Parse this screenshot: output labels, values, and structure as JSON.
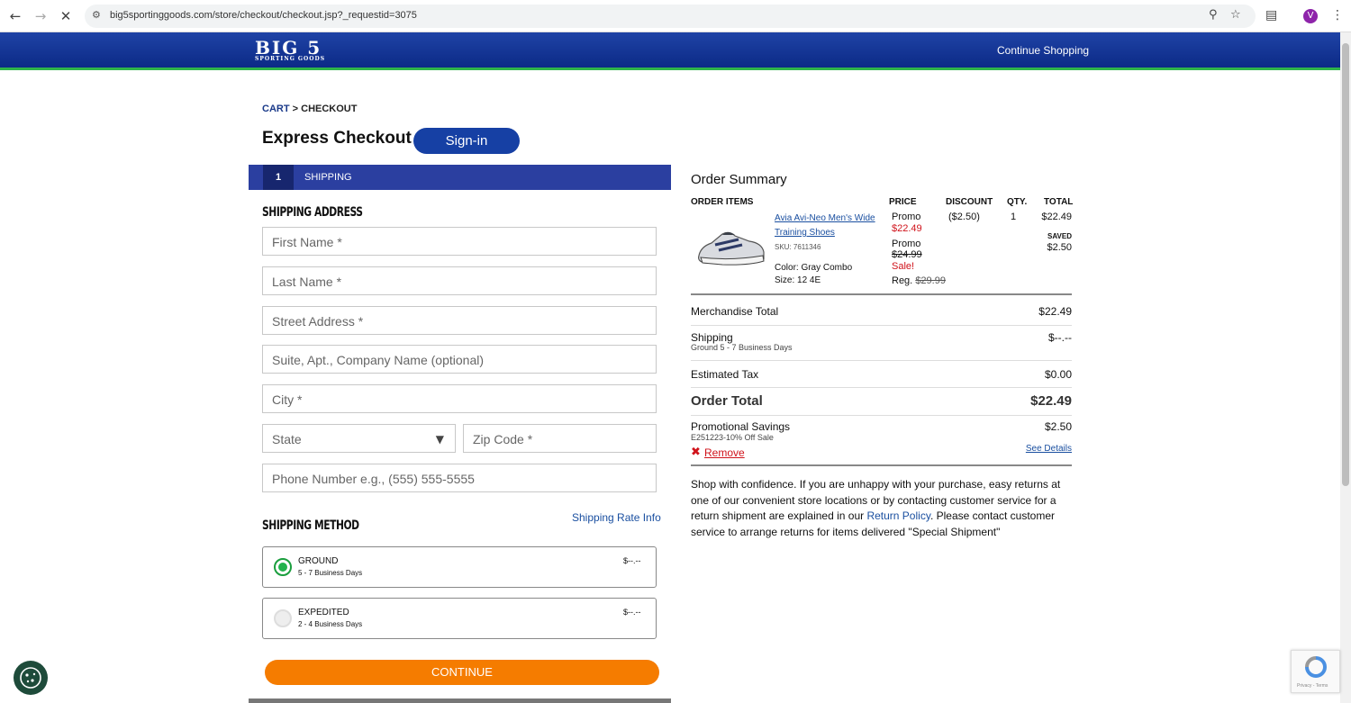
{
  "browser": {
    "url": "big5sportinggoods.com/store/checkout/checkout.jsp?_requestid=3075",
    "profile_initial": "V"
  },
  "header": {
    "logo_main": "BIG 5",
    "logo_sub": "SPORTING GOODS",
    "continue_shopping": "Continue Shopping"
  },
  "breadcrumb": {
    "cart": "CART",
    "sep": ">",
    "current": "CHECKOUT"
  },
  "page": {
    "title": "Express Checkout",
    "signin_label": "Sign-in"
  },
  "step": {
    "number": "1",
    "label": "SHIPPING"
  },
  "shipping_address": {
    "heading": "SHIPPING ADDRESS",
    "first_name": "First Name *",
    "last_name": "Last Name *",
    "street": "Street Address *",
    "suite": "Suite, Apt., Company Name (optional)",
    "city": "City *",
    "state": "State",
    "zip": "Zip Code *",
    "phone": "Phone Number e.g., (555) 555-5555"
  },
  "shipping_method": {
    "heading": "SHIPPING METHOD",
    "rate_info": "Shipping Rate Info",
    "options": [
      {
        "name": "GROUND",
        "days": "5 - 7 Business Days",
        "price": "$--.--",
        "selected": true
      },
      {
        "name": "EXPEDITED",
        "days": "2 - 4 Business Days",
        "price": "$--.--",
        "selected": false
      }
    ],
    "continue_label": "CONTINUE"
  },
  "order_summary": {
    "title": "Order Summary",
    "columns": {
      "items": "ORDER ITEMS",
      "price": "PRICE",
      "discount": "DISCOUNT",
      "qty": "QTY.",
      "total": "TOTAL"
    },
    "item": {
      "name": "Avia Avi-Neo Men's Wide Training Shoes",
      "sku": "SKU:  7611346",
      "color": "Color:  Gray Combo",
      "size": "Size:  12 4E",
      "promo_label_1": "Promo",
      "promo_price": "$22.49",
      "promo_label_2": "Promo",
      "was_price": "$24.99",
      "sale": "Sale!",
      "reg_label": "Reg.",
      "reg_price": "$29.99",
      "discount": "($2.50)",
      "qty": "1",
      "total": "$22.49",
      "saved_label": "SAVED",
      "saved_amount": "$2.50"
    },
    "merch_total_label": "Merchandise Total",
    "merch_total": "$22.49",
    "shipping_label": "Shipping",
    "shipping_sub": "Ground  5 - 7 Business Days",
    "shipping_value": "$--.--",
    "tax_label": "Estimated Tax",
    "tax_value": "$0.00",
    "order_total_label": "Order Total",
    "order_total": "$22.49",
    "promo_label": "Promotional Savings",
    "promo_code": "E251223-10% Off Sale",
    "promo_value": "$2.50",
    "remove_label": "Remove",
    "see_details": "See Details",
    "confidence_1": "Shop with confidence. If you are unhappy with your purchase, easy returns at one of our convenient store locations or by contacting customer service for a return shipment are explained in our ",
    "return_policy": "Return Policy",
    "confidence_2": ". Please contact customer service to arrange returns for items delivered \"Special Shipment\""
  },
  "colors": {
    "brand_blue": "#0c2a86",
    "accent_orange": "#f57c00",
    "promo_red": "#d0131b",
    "radio_green": "#21b24b"
  }
}
